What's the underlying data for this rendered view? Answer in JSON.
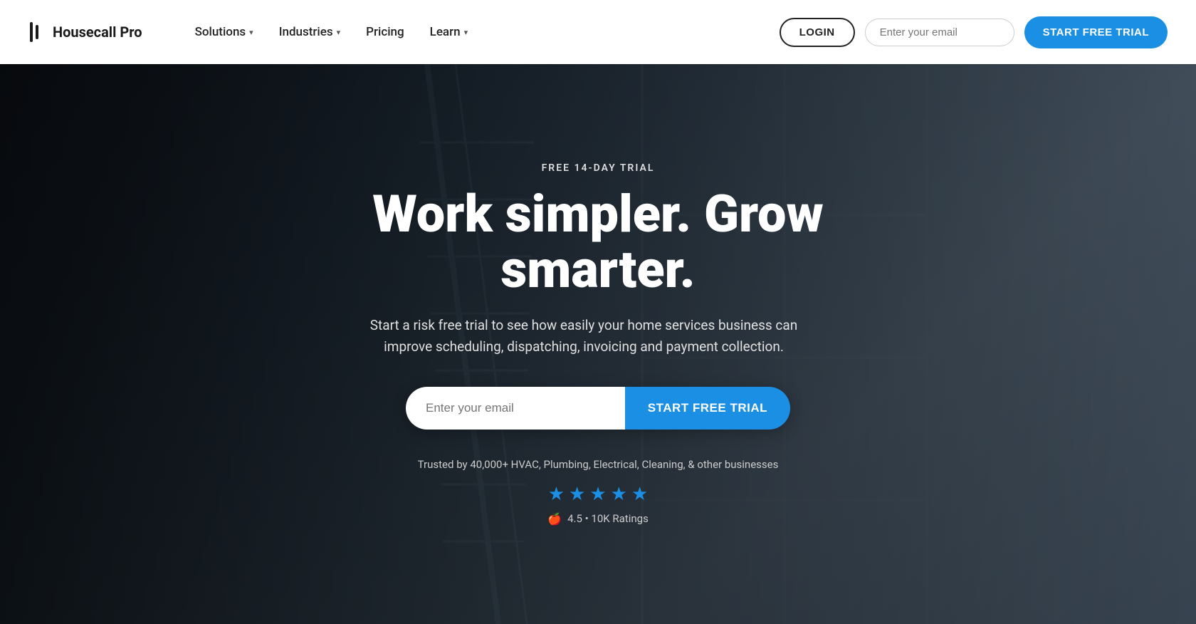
{
  "nav": {
    "logo_text": "Housecall Pro",
    "links": [
      {
        "label": "Solutions",
        "has_dropdown": true
      },
      {
        "label": "Industries",
        "has_dropdown": true
      },
      {
        "label": "Pricing",
        "has_dropdown": false
      },
      {
        "label": "Learn",
        "has_dropdown": true
      }
    ],
    "login_label": "LOGIN",
    "email_placeholder": "Enter your email",
    "trial_label": "START FREE TRIAL"
  },
  "hero": {
    "badge": "FREE 14-DAY TRIAL",
    "title": "Work simpler. Grow smarter.",
    "subtitle": "Start a risk free trial to see how easily your home services business can improve scheduling, dispatching, invoicing and payment collection.",
    "email_placeholder": "Enter your email",
    "trial_label": "START FREE TRIAL",
    "trust_text": "Trusted by 40,000+ HVAC, Plumbing, Electrical, Cleaning, & other businesses",
    "stars_count": 5,
    "rating_text": "4.5 • 10K Ratings"
  }
}
